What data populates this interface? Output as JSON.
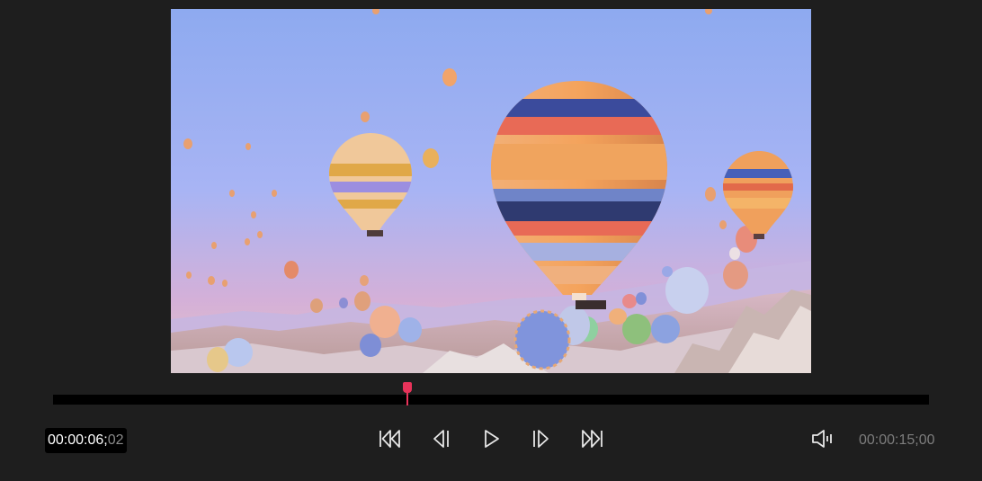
{
  "player": {
    "current_time": "00:00:06;",
    "current_frames": "02",
    "total_time": "00:00:15;00",
    "progress_fraction": 0.405
  },
  "controls": {
    "skip_to_start_icon": "skip-to-start-icon",
    "previous_frame_icon": "previous-frame-icon",
    "play_icon": "play-icon",
    "next_frame_icon": "next-frame-icon",
    "skip_to_end_icon": "skip-to-end-icon",
    "volume_icon": "volume-icon"
  },
  "colors": {
    "background": "#1e1e1e",
    "playhead": "#e8335a",
    "icon": "#e6e6e6",
    "total_time": "#7d7d7d"
  }
}
